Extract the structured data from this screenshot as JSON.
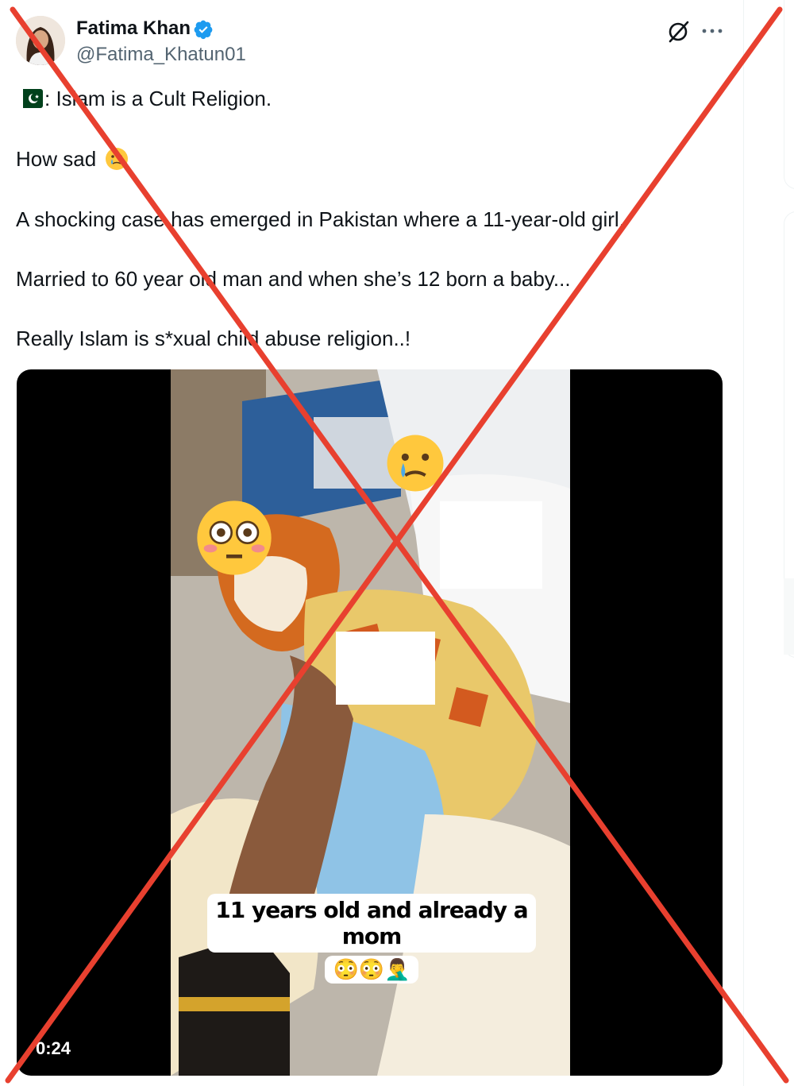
{
  "author": {
    "name": "Fatima Khan",
    "handle": "@Fatima_Khatun01",
    "verified": true
  },
  "post": {
    "line1_text": ": Islam is a Cult Religion.",
    "line2_text": "How sad",
    "line3_text": "A shocking case has emerged in Pakistan where a 11-year-old girl.",
    "line4_text": "Married to 60 year old man and when she’s 12 born a baby...",
    "line5_text": "Really Islam is s*xual child abuse religion..!"
  },
  "video": {
    "caption_line1": "11 years old and already a mom",
    "caption_emojis": "😳😳🤦‍♂️",
    "duration": "0:24"
  },
  "icons": {
    "flag": "pakistan-flag-icon",
    "sad": "crying-face-icon",
    "verified": "verified-badge-icon",
    "grok": "grok-icon",
    "more": "more-icon"
  },
  "colors": {
    "cross": "#e8402f",
    "verified": "#1d9bf0",
    "handle": "#536471",
    "text": "#0f1419"
  }
}
